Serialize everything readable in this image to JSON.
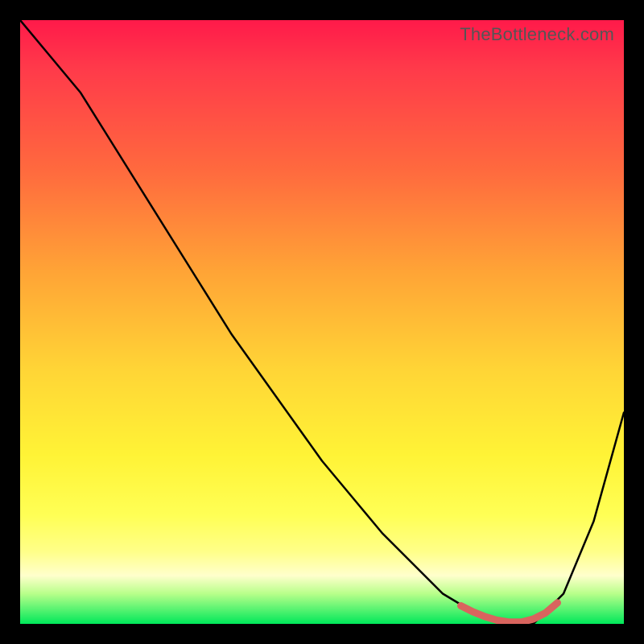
{
  "watermark": "TheBottleneck.com",
  "chart_data": {
    "type": "line",
    "title": "",
    "xlabel": "",
    "ylabel": "",
    "xlim": [
      0,
      100
    ],
    "ylim": [
      0,
      100
    ],
    "series": [
      {
        "name": "curve",
        "color": "#000000",
        "x": [
          0,
          5,
          10,
          15,
          20,
          25,
          30,
          35,
          40,
          45,
          50,
          55,
          60,
          65,
          70,
          75,
          80,
          85,
          90,
          95,
          100
        ],
        "y": [
          100,
          94,
          88,
          80,
          72,
          64,
          56,
          48,
          41,
          34,
          27,
          21,
          15,
          10,
          5,
          2,
          0,
          0,
          5,
          17,
          35
        ]
      },
      {
        "name": "highlight",
        "color": "#d9645e",
        "x": [
          73,
          75,
          77,
          79,
          81,
          83,
          85,
          87,
          89
        ],
        "y": [
          3,
          2,
          1.2,
          0.6,
          0.3,
          0.3,
          0.8,
          1.8,
          3.5
        ]
      }
    ]
  }
}
